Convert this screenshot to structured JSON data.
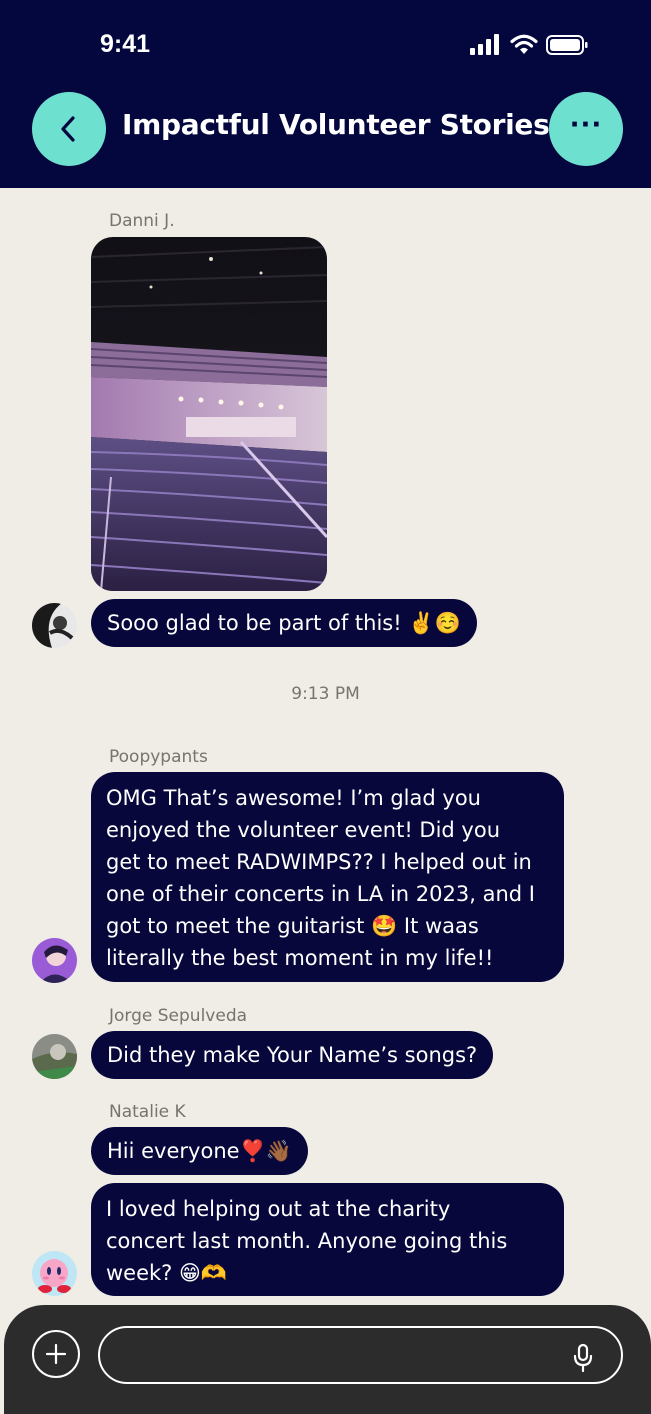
{
  "status_bar": {
    "time": "9:41"
  },
  "header": {
    "title": "Impactful Volunteer Stories",
    "back_icon": "chevron-left-icon",
    "more_icon": "ellipsis-icon"
  },
  "messages": [
    {
      "sender": "Danni J.",
      "image": "concert-arena-photo",
      "text": "Sooo glad to be part of this! ✌️☺️"
    },
    {
      "timestamp": "9:13 PM"
    },
    {
      "sender": "Poopypants",
      "lines": [
        "OMG That’s awesome! I’m glad you",
        "enjoyed the volunteer event! Did you",
        "get to meet RADWIMPS?? I helped out in",
        "one of their concerts in LA in 2023, and I",
        "got to meet the guitarist 🤩 It waas",
        "literally the best moment in my life!!"
      ]
    },
    {
      "sender": "Jorge Sepulveda",
      "text": "Did they make Your Name’s songs?"
    },
    {
      "sender": "Natalie K",
      "text": "Hii everyone❣️👋🏾",
      "lines": [
        "I loved helping out at the charity",
        "concert last month. Anyone going this",
        "week? 😁🫶"
      ]
    }
  ],
  "composer": {
    "placeholder": "",
    "add_icon": "plus-icon",
    "mic_icon": "microphone-icon"
  },
  "colors": {
    "header_bg": "#04063e",
    "accent": "#6ee0cf",
    "bubble_bg": "#07073c",
    "chat_bg": "#efede6",
    "composer_bg": "#2c2c2c"
  }
}
